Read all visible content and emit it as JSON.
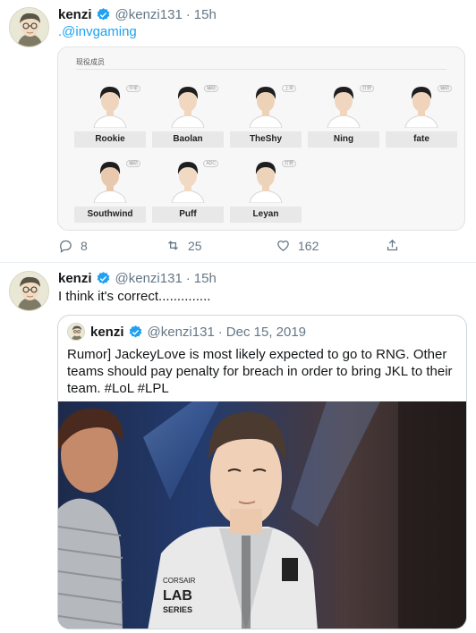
{
  "tweets": [
    {
      "author_name": "kenzi",
      "handle": "@kenzi131",
      "separator": "·",
      "time": "15h",
      "text_prefix": ".",
      "mention": "@invgaming",
      "roster": {
        "title": "现役成员",
        "players": [
          {
            "name": "Rookie",
            "role": "中单"
          },
          {
            "name": "Baolan",
            "role": "辅助"
          },
          {
            "name": "TheShy",
            "role": "上单"
          },
          {
            "name": "Ning",
            "role": "打野"
          },
          {
            "name": "fate",
            "role": "辅助"
          },
          {
            "name": "Southwind",
            "role": "辅助"
          },
          {
            "name": "Puff",
            "role": "ADC"
          },
          {
            "name": "Leyan",
            "role": "打野"
          }
        ]
      },
      "actions": {
        "replies": "8",
        "retweets": "25",
        "likes": "162"
      }
    },
    {
      "author_name": "kenzi",
      "handle": "@kenzi131",
      "separator": "·",
      "time": "15h",
      "text": "I think it's correct..............",
      "quoted": {
        "author_name": "kenzi",
        "handle": "@kenzi131",
        "separator": "·",
        "date": "Dec 15, 2019",
        "text": "Rumor] JackeyLove is most likely expected to go to RNG. Other teams should pay penalty for breach in order to bring JKL to their team.  #LoL  #LPL",
        "photo_text": {
          "jersey_line1": "CORSAIR",
          "jersey_line2": "LAB",
          "jersey_line3": "SERIES"
        }
      }
    }
  ],
  "colors": {
    "link": "#1da1f2",
    "verified": "#1da1f2",
    "muted": "#657786"
  }
}
